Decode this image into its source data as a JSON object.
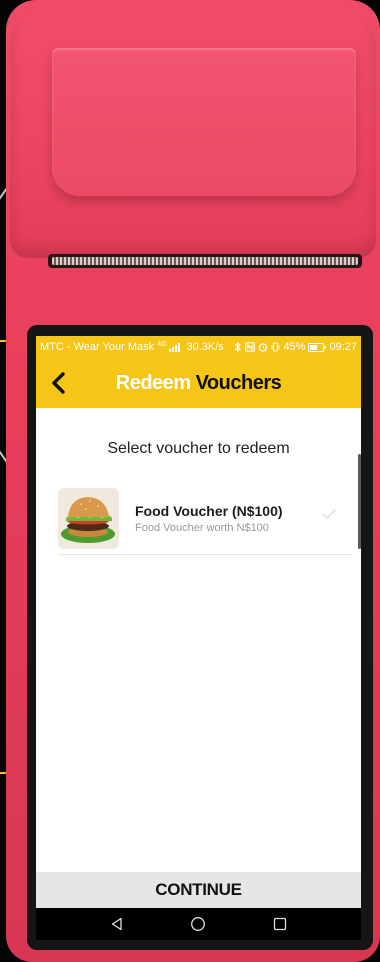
{
  "status_bar": {
    "carrier": "MTC - Wear Your Mask",
    "network": "4G",
    "speed": "30.3K/s",
    "battery_percent": "45%",
    "battery_level": 0.45,
    "time": "09:27"
  },
  "header": {
    "back_icon": "chevron-left-icon",
    "title_part1": "Redeem",
    "title_part2": "Vouchers",
    "background_color": "#f5c518"
  },
  "content": {
    "heading": "Select voucher to redeem",
    "vouchers": [
      {
        "name": "Food Voucher (N$100)",
        "description": "Food Voucher worth N$100",
        "image": "burger-image",
        "selected": false
      }
    ]
  },
  "footer": {
    "continue_label": "CONTINUE"
  },
  "nav_bar": {
    "icons": [
      "back-triangle-icon",
      "home-circle-icon",
      "recents-square-icon"
    ]
  },
  "device": {
    "body_color": "#e8425e",
    "accent_color": "#f2c21b"
  }
}
